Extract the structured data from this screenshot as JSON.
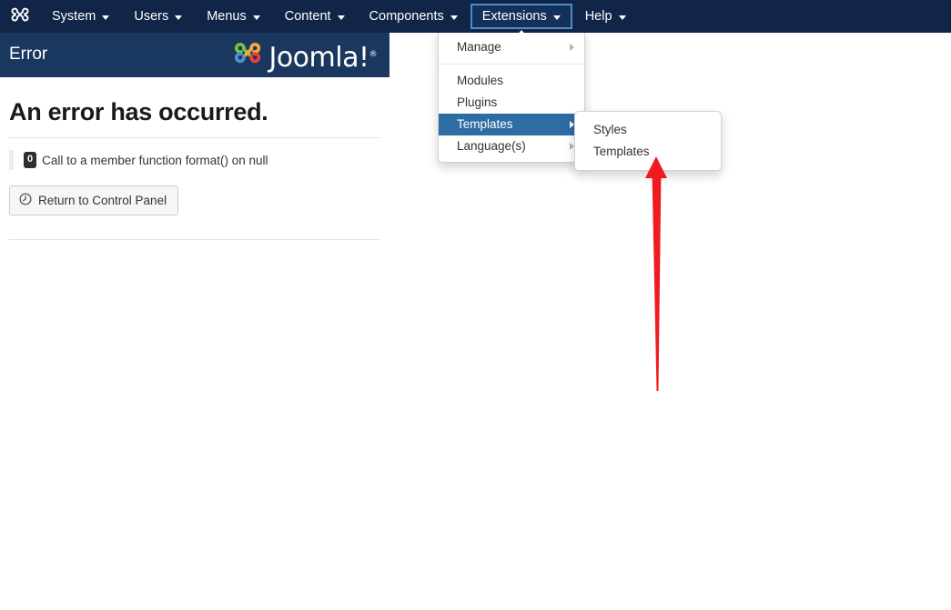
{
  "topbar": {
    "brand_icon": "joomla-logo-icon",
    "items": [
      {
        "label": "System",
        "has_caret": true,
        "active": false
      },
      {
        "label": "Users",
        "has_caret": true,
        "active": false
      },
      {
        "label": "Menus",
        "has_caret": true,
        "active": false
      },
      {
        "label": "Content",
        "has_caret": true,
        "active": false
      },
      {
        "label": "Components",
        "has_caret": true,
        "active": false
      },
      {
        "label": "Extensions",
        "has_caret": true,
        "active": true
      },
      {
        "label": "Help",
        "has_caret": true,
        "active": false
      }
    ],
    "active_border_color": "#4a90c4",
    "background_color": "#102548"
  },
  "page_header": {
    "title": "Error",
    "logo_text": "Joomla!",
    "logo_registered": "®",
    "background_color": "#1a3760",
    "logo_colors": {
      "green": "#7ac143",
      "orange": "#f9a541",
      "blue": "#5091cd",
      "red": "#ee4036"
    }
  },
  "error": {
    "heading": "An error has occurred.",
    "code_badge": "0",
    "message": "Call to a member function format() on null",
    "button_label": "Return to Control Panel",
    "button_icon": "back-arrow-circle-icon"
  },
  "dropdown": {
    "items": [
      {
        "label": "Manage",
        "submenu_arrow": true,
        "selected": false,
        "separator_after": true
      },
      {
        "label": "Modules",
        "submenu_arrow": false,
        "selected": false,
        "separator_after": false
      },
      {
        "label": "Plugins",
        "submenu_arrow": false,
        "selected": false,
        "separator_after": false
      },
      {
        "label": "Templates",
        "submenu_arrow": true,
        "selected": true,
        "separator_after": false
      },
      {
        "label": "Language(s)",
        "submenu_arrow": true,
        "selected": false,
        "separator_after": false
      }
    ],
    "highlight_color": "#2e6ca4"
  },
  "submenu": {
    "items": [
      {
        "label": "Styles"
      },
      {
        "label": "Templates"
      }
    ]
  },
  "annotation": {
    "arrow_color": "#ee1c22",
    "points_to": "Templates"
  }
}
